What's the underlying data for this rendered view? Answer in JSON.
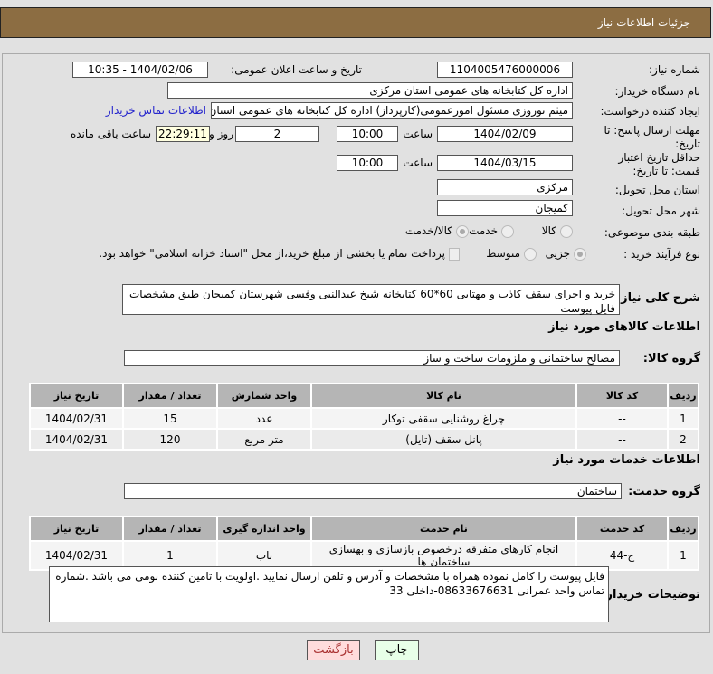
{
  "header": {
    "title": "جزئیات اطلاعات نیاز"
  },
  "form": {
    "need_number_label": "شماره نیاز:",
    "need_number": "1104005476000006",
    "announce_label": "تاریخ و ساعت اعلان عمومی:",
    "announce_value": "1404/02/06 - 10:35",
    "buyer_label": "نام دستگاه خریدار:",
    "buyer": "اداره کل کتابخانه های عمومی استان مرکزی",
    "creator_label": "ایجاد کننده درخواست:",
    "creator": "میثم نوروزی مسئول امورعمومی(کارپرداز) اداره کل کتابخانه های عمومی استان",
    "contact_link": "اطلاعات تماس خریدار",
    "deadline_label": "مهلت ارسال پاسخ: تا تاریخ:",
    "deadline_date": "1404/02/09",
    "time_label": "ساعت",
    "deadline_time": "10:00",
    "days": "2",
    "days_label": "روز و",
    "remaining": "22:29:11",
    "remaining_label": "ساعت باقی مانده",
    "validity_label": "حداقل تاریخ اعتبار قیمت: تا تاریخ:",
    "validity_date": "1404/03/15",
    "validity_time": "10:00",
    "province_label": "استان محل تحویل:",
    "province": "مرکزی",
    "city_label": "شهر محل تحویل:",
    "city": "کمیجان",
    "category_label": "طبقه بندی موضوعی:",
    "category_options": [
      "کالا",
      "خدمت",
      "کالا/خدمت"
    ],
    "process_label": "نوع فرآیند خرید :",
    "process_options": [
      "جزیی",
      "متوسط"
    ],
    "payment_note": "پرداخت تمام یا بخشی از مبلغ خرید،از محل \"اسناد خزانه اسلامی\" خواهد بود.",
    "description_label": "شرح کلی نیاز:",
    "description": "خرید و اجرای سقف کاذب  و مهتابی 60*60 کتابخانه شیخ عبدالنبی وفسی شهرستان کمیجان طبق مشخصات فایل پیوست"
  },
  "goods": {
    "section_title": "اطلاعات کالاهای مورد نیاز",
    "group_label": "گروه کالا:",
    "group": "مصالح ساختمانی و ملزومات ساخت و ساز",
    "columns": [
      "ردیف",
      "کد کالا",
      "نام کالا",
      "واحد شمارش",
      "تعداد / مقدار",
      "تاریخ نیاز"
    ],
    "rows": [
      [
        "1",
        "--",
        "چراغ روشنایی سقفی توکار",
        "عدد",
        "15",
        "1404/02/31"
      ],
      [
        "2",
        "--",
        "پانل سقف (تایل)",
        "متر مربع",
        "120",
        "1404/02/31"
      ]
    ]
  },
  "services": {
    "section_title": "اطلاعات خدمات مورد نیاز",
    "group_label": "گروه خدمت:",
    "group": "ساختمان",
    "columns": [
      "ردیف",
      "کد خدمت",
      "نام خدمت",
      "واحد اندازه گیری",
      "تعداد / مقدار",
      "تاریخ نیاز"
    ],
    "rows": [
      [
        "1",
        "ج-44",
        "انجام کارهای متفرقه درخصوص بازسازی و بهسازی ساختمان ها",
        "باب",
        "1",
        "1404/02/31"
      ]
    ]
  },
  "notes": {
    "label": "توضیحات خریدار:",
    "text": "فایل پیوست را کامل نموده همراه با مشخصات و آدرس و تلفن ارسال نمایید .اولویت با تامین کننده بومی می باشد .شماره تماس واحد عمرانی 08633676631-داخلی 33"
  },
  "buttons": {
    "print": "چاپ",
    "back": "بازگشت"
  }
}
